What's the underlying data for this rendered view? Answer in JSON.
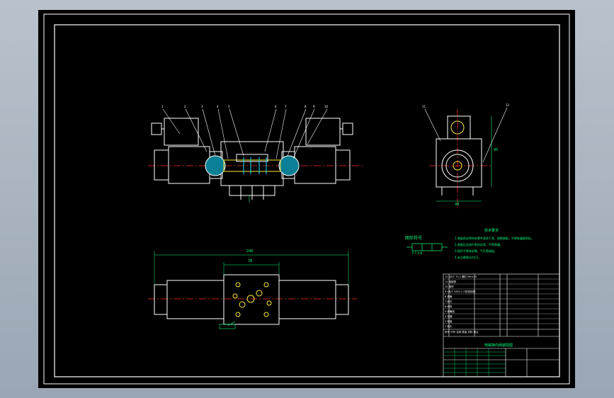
{
  "drawing": {
    "title_block_name": "电磁换向阀装配图",
    "tech_requirements_title": "技术要求",
    "tech_requirements": [
      "1.装配前应将所有零件清洗干净，按图装配，不得有磕碰划伤。",
      "2.装配后应进行密封试验，不得渗漏。",
      "3.铸件不得有砂眼、气孔等缺陷。",
      "4.未注倒角均为C1。"
    ],
    "symbol_caption": "图形符号",
    "port_note": "P T A B",
    "dimension_overall": "246",
    "dimension_body": "78",
    "dimension_height": "95",
    "dimension_side": "48",
    "balloons": [
      "1",
      "2",
      "3",
      "4",
      "5",
      "6",
      "7",
      "8",
      "9",
      "10",
      "11",
      "12"
    ],
    "bom_header": [
      "序号",
      "代号",
      "名称",
      "数量",
      "材料",
      "备注"
    ],
    "bom_rows": [
      [
        "12",
        "GB/T 70.1",
        "螺钉 M5×30",
        "4",
        "35",
        ""
      ],
      [
        "11",
        "",
        "电磁铁",
        "2",
        "组合件",
        ""
      ],
      [
        "10",
        "",
        "推杆",
        "2",
        "45",
        ""
      ],
      [
        "9",
        "GB/T 3452.1",
        "O形密封圈",
        "4",
        "丁腈橡胶",
        ""
      ],
      [
        "8",
        "",
        "弹簧",
        "2",
        "65Mn",
        ""
      ],
      [
        "7",
        "",
        "阀芯",
        "1",
        "40Cr",
        ""
      ],
      [
        "6",
        "",
        "阀体",
        "1",
        "HT300",
        ""
      ],
      [
        "5",
        "",
        "弹簧座",
        "2",
        "45",
        ""
      ],
      [
        "4",
        "",
        "挡圈",
        "2",
        "65Mn",
        ""
      ],
      [
        "3",
        "",
        "端盖",
        "2",
        "HT200",
        ""
      ],
      [
        "2",
        "",
        "插头",
        "2",
        "组合件",
        ""
      ],
      [
        "1",
        "",
        "线圈",
        "2",
        "组合件",
        ""
      ]
    ]
  }
}
